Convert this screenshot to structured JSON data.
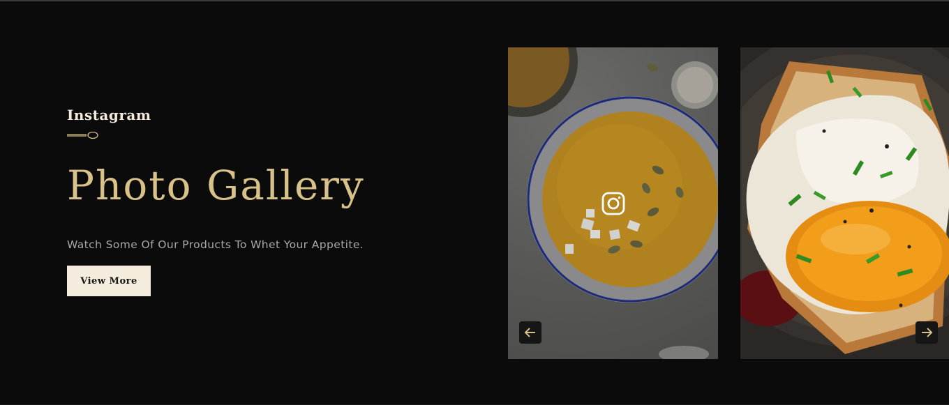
{
  "section": {
    "eyebrow": "Instagram",
    "title": "Photo Gallery",
    "subtitle": "Watch Some Of Our Products To Whet Your Appetite.",
    "button_label": "View More"
  },
  "gallery": {
    "items": [
      {
        "name": "soup-photo",
        "icon": "instagram-icon"
      },
      {
        "name": "egg-toast-photo"
      }
    ],
    "prev_icon": "arrow-left-icon",
    "next_icon": "arrow-right-icon"
  },
  "colors": {
    "background": "#0b0b0b",
    "accent_gold": "#d9c28a",
    "button_bg": "#f4ecdc",
    "text_muted": "#a8a8a8"
  }
}
